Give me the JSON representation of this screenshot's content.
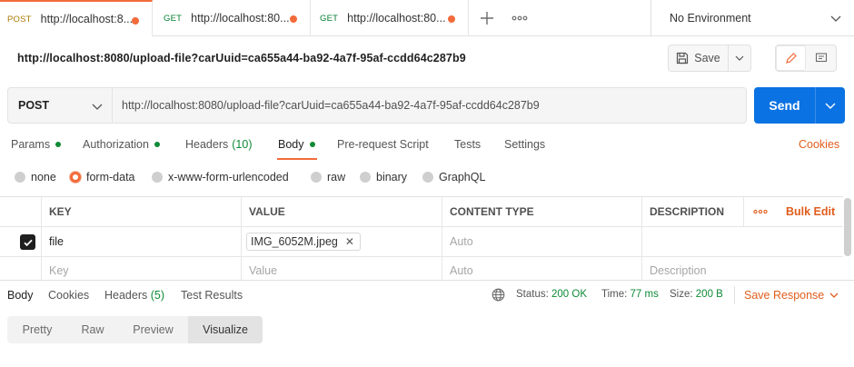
{
  "colors": {
    "accent": "#f26b3a",
    "send": "#0a72e3",
    "ok_green": "#0f8a36",
    "post_method": "#ad7a03",
    "get_method": "#007f31"
  },
  "tabs": [
    {
      "method": "POST",
      "url": "http://localhost:8...",
      "unsaved": true,
      "active": true
    },
    {
      "method": "GET",
      "url": "http://localhost:80...",
      "unsaved": true,
      "active": false
    },
    {
      "method": "GET",
      "url": "http://localhost:80...",
      "unsaved": true,
      "active": false
    }
  ],
  "tab_icons": {
    "new_tab": "plus-icon",
    "more_tabs": "ellipsis-icon"
  },
  "environment": {
    "label": "No Environment"
  },
  "request": {
    "title": "http://localhost:8080/upload-file?carUuid=ca655a44-ba92-4a7f-95af-ccdd64c287b9",
    "save_label": "Save",
    "method": "POST",
    "url": "http://localhost:8080/upload-file?carUuid=ca655a44-ba92-4a7f-95af-ccdd64c287b9",
    "send_label": "Send"
  },
  "request_tabs": [
    {
      "label": "Params",
      "dot": true
    },
    {
      "label": "Authorization",
      "dot": true
    },
    {
      "label": "Headers",
      "count": "(10)"
    },
    {
      "label": "Body",
      "dot": true,
      "active": true
    },
    {
      "label": "Pre-request Script"
    },
    {
      "label": "Tests"
    },
    {
      "label": "Settings"
    }
  ],
  "cookies_label": "Cookies",
  "body_types": [
    {
      "label": "none",
      "selected": false
    },
    {
      "label": "form-data",
      "selected": true
    },
    {
      "label": "x-www-form-urlencoded",
      "selected": false
    },
    {
      "label": "raw",
      "selected": false
    },
    {
      "label": "binary",
      "selected": false
    },
    {
      "label": "GraphQL",
      "selected": false
    }
  ],
  "table": {
    "headers": {
      "key": "KEY",
      "value": "VALUE",
      "content_type": "CONTENT TYPE",
      "description": "DESCRIPTION",
      "bulk_edit": "Bulk Edit"
    },
    "rows": [
      {
        "checked": true,
        "key": "file",
        "value_file": "IMG_6052M.jpeg",
        "content_type_placeholder": "Auto",
        "description": ""
      }
    ],
    "placeholder_row": {
      "key": "Key",
      "value": "Value",
      "content_type": "Auto",
      "description": "Description"
    }
  },
  "response": {
    "tabs": [
      {
        "label": "Body",
        "active": true
      },
      {
        "label": "Cookies"
      },
      {
        "label": "Headers",
        "count": "(5)"
      },
      {
        "label": "Test Results"
      }
    ],
    "status_label": "Status:",
    "status_value": "200 OK",
    "time_label": "Time:",
    "time_value": "77 ms",
    "size_label": "Size:",
    "size_value": "200 B",
    "save_response_label": "Save Response",
    "view_modes": [
      {
        "label": "Pretty"
      },
      {
        "label": "Raw"
      },
      {
        "label": "Preview"
      },
      {
        "label": "Visualize",
        "active": true
      }
    ]
  }
}
